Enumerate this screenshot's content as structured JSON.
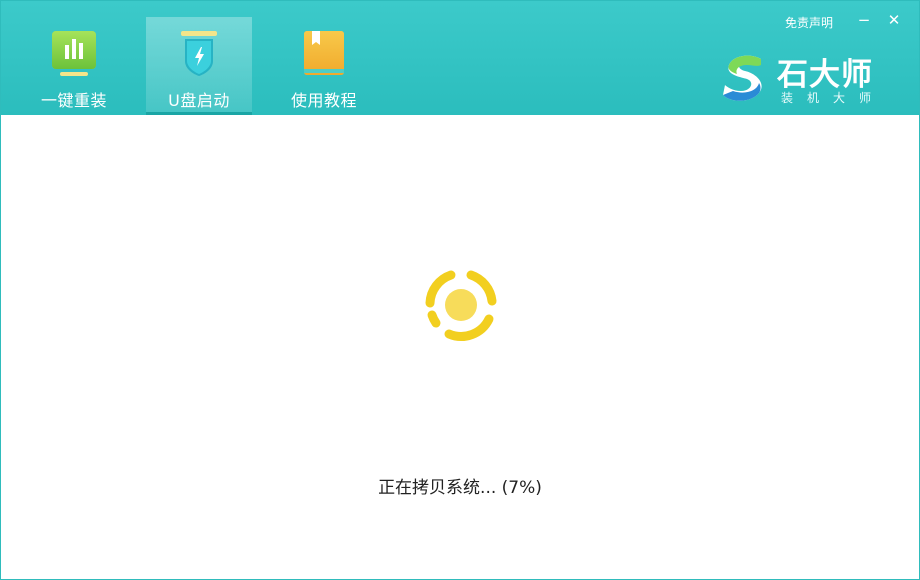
{
  "tabs": [
    {
      "label": "一键重装",
      "icon": "chart-icon",
      "active": false
    },
    {
      "label": "U盘启动",
      "icon": "usb-shield-icon",
      "active": true
    },
    {
      "label": "使用教程",
      "icon": "book-icon",
      "active": false
    }
  ],
  "header": {
    "disclaimer": "免责声明",
    "minimize": "−",
    "close": "✕"
  },
  "logo": {
    "name": "石大师",
    "subtitle": "装机大师"
  },
  "status": {
    "text": "正在拷贝系统... (7%)",
    "progress_percent": 7
  },
  "colors": {
    "header": "#2fc1c1",
    "spinner": "#f2cf1f",
    "spinner_center": "#f7dc5a"
  }
}
